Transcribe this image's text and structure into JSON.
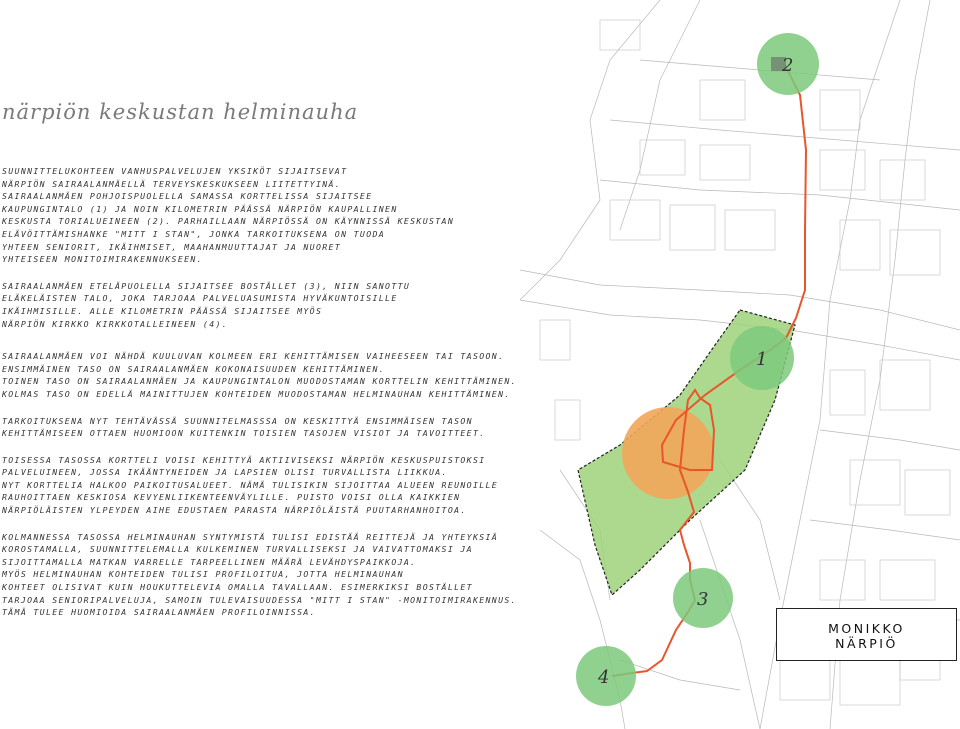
{
  "title": "närpiön keskustan helminauha",
  "paragraphs": [
    {
      "lines": [
        "SUUNNITTELUKOHTEEN VANHUSPALVELUJEN YKSIKÖT SIJAITSEVAT",
        "NÄRPIÖN SAIRAALANMÄELLÄ TERVEYSKESKUKSEEN LIITETTYINÄ.",
        "SAIRAALANMÄEN POHJOISPUOLELLA SAMASSA KORTTELISSA SIJAITSEE",
        "KAUPUNGINTALO (1) JA NOIN KILOMETRIN PÄÄSSÄ NÄRPIÖN KAUPALLINEN",
        "KESKUSTA TORIALUEINEEN (2). PARHAILLAAN NÄRPIÖSSÄ ON KÄYNNISSÄ KESKUSTAN",
        "ELÄVÖITTÄMISHANKE \"MITT I STAN\", JONKA TARKOITUKSENA ON TUODA",
        "YHTEEN SENIORIT, IKÄIHMISET, MAAHANMUUTTAJAT JA NUORET",
        "YHTEISEEN MONITOIMIRAKENNUKSEEN."
      ]
    },
    {
      "lines": [
        "SAIRAALANMÄEN ETELÄPUOLELLA SIJAITSEE BOSTÄLLET (3), NIIN SANOTTU",
        "ELÄKELÄISTEN TALO, JOKA TARJOAA PALVELUASUMISTA HYVÄKUNTOISILLE",
        "IKÄIHMISILLE. ALLE KILOMETRIN PÄÄSSÄ SIJAITSEE MYÖS",
        "NÄRPIÖN KIRKKO KIRKKOTALLEINEEN (4)."
      ]
    },
    {
      "lines": [
        "SAIRAALANMÄEN VOI NÄHDÄ KUULUVAN KOLMEEN ERI KEHITTÄMISEN VAIHEESEEN TAI TASOON.",
        "ENSIMMÄINEN TASO ON SAIRAALANMÄEN KOKONAISUUDEN KEHITTÄMINEN.",
        "TOINEN TASO ON SAIRAALANMÄEN JA KAUPUNGINTALON MUODOSTAMAN KORTTELIN KEHITTÄMINEN.",
        "KOLMAS TASO ON EDELLÄ MAINITTUJEN KOHTEIDEN MUODOSTAMAN HELMINAUHAN KEHITTÄMINEN."
      ]
    },
    {
      "lines": [
        "TARKOITUKSENA NYT TEHTÄVÄSSÄ SUUNNITELMASSSA ON KESKITTYÄ ENSIMMÄISEN TASON",
        "KEHITTÄMISEEN OTTAEN HUOMIOON KUITENKIN TOISIEN TASOJEN VISIOT JA TAVOITTEET."
      ]
    },
    {
      "lines": [
        "TOISESSA TASOSSA KORTTELI VOISI KEHITTYÄ AKTIIVISEKSI NÄRPIÖN KESKUSPUISTOKSI",
        "PALVELUINEEN, JOSSA IKÄÄNTYNEIDEN JA LAPSIEN OLISI TURVALLISTA LIIKKUA.",
        "NYT KORTTELIA HALKOO PAIKOITUSALUEET. NÄMÄ TULISIKIN SIJOITTAA ALUEEN REUNOILLE",
        "RAUHOITTAEN KESKIOSA KEVYENLIIKENTEENVÄYLILLE. PUISTO VOISI OLLA KAIKKIEN",
        "NÄRPIÖLÄISTEN YLPEYDEN AIHE EDUSTAEN PARASTA NÄRPIÖLÄISTÄ PUUTARHANHOITOA."
      ]
    },
    {
      "lines": [
        "KOLMANNESSA TASOSSA HELMINAUHAN SYNTYMISTÄ TULISI EDISTÄÄ REITTEJÄ JA YHTEYKSIÄ",
        "KOROSTAMALLA, SUUNNITTELEMALLA KULKEMINEN TURVALLISEKSI JA VAIVATTOMAKSI JA",
        "SIJOITTAMALLA MATKAN VARRELLE TARPEELLINEN MÄÄRÄ LEVÄHDYSPAIKKOJA.",
        "MYÖS HELMINAUHAN KOHTEIDEN TULISI PROFILOITUA, JOTTA HELMINAUHAN",
        "KOHTEET OLISIVAT KUIN HOUKUTTELEVIA OMALLA TAVALLAAN. ESIMERKIKSI BOSTÄLLET",
        "TARJOAA SENIORIPALVELUJA, SAMOIN TULEVAISUUDESSA \"MITT I STAN\" -MONITOIMIRAKENNUS.",
        "TÄMÄ TULEE HUOMIOIDA SAIRAALANMÄEN PROFILOINNISSA."
      ]
    }
  ],
  "map": {
    "markers": [
      {
        "id": "1",
        "label": "1",
        "color": "#7cc97c"
      },
      {
        "id": "2",
        "label": "2",
        "color": "#7cc97c"
      },
      {
        "id": "3",
        "label": "3",
        "color": "#7cc97c"
      },
      {
        "id": "4",
        "label": "4",
        "color": "#7cc97c"
      }
    ],
    "focus_color": "#f2a65a",
    "park_color": "#9fd27a",
    "route_color": "#e8562a"
  },
  "logo": {
    "line1": "MONIKKO",
    "line2": "NÄRPIÖ"
  }
}
